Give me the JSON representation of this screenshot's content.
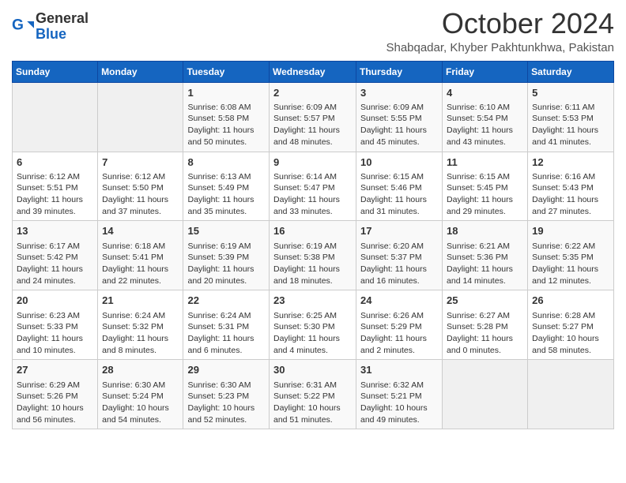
{
  "header": {
    "logo_general": "General",
    "logo_blue": "Blue",
    "month_title": "October 2024",
    "location": "Shabqadar, Khyber Pakhtunkhwa, Pakistan"
  },
  "days_of_week": [
    "Sunday",
    "Monday",
    "Tuesday",
    "Wednesday",
    "Thursday",
    "Friday",
    "Saturday"
  ],
  "weeks": [
    [
      {
        "day": "",
        "content": ""
      },
      {
        "day": "",
        "content": ""
      },
      {
        "day": "1",
        "content": "Sunrise: 6:08 AM\nSunset: 5:58 PM\nDaylight: 11 hours and 50 minutes."
      },
      {
        "day": "2",
        "content": "Sunrise: 6:09 AM\nSunset: 5:57 PM\nDaylight: 11 hours and 48 minutes."
      },
      {
        "day": "3",
        "content": "Sunrise: 6:09 AM\nSunset: 5:55 PM\nDaylight: 11 hours and 45 minutes."
      },
      {
        "day": "4",
        "content": "Sunrise: 6:10 AM\nSunset: 5:54 PM\nDaylight: 11 hours and 43 minutes."
      },
      {
        "day": "5",
        "content": "Sunrise: 6:11 AM\nSunset: 5:53 PM\nDaylight: 11 hours and 41 minutes."
      }
    ],
    [
      {
        "day": "6",
        "content": "Sunrise: 6:12 AM\nSunset: 5:51 PM\nDaylight: 11 hours and 39 minutes."
      },
      {
        "day": "7",
        "content": "Sunrise: 6:12 AM\nSunset: 5:50 PM\nDaylight: 11 hours and 37 minutes."
      },
      {
        "day": "8",
        "content": "Sunrise: 6:13 AM\nSunset: 5:49 PM\nDaylight: 11 hours and 35 minutes."
      },
      {
        "day": "9",
        "content": "Sunrise: 6:14 AM\nSunset: 5:47 PM\nDaylight: 11 hours and 33 minutes."
      },
      {
        "day": "10",
        "content": "Sunrise: 6:15 AM\nSunset: 5:46 PM\nDaylight: 11 hours and 31 minutes."
      },
      {
        "day": "11",
        "content": "Sunrise: 6:15 AM\nSunset: 5:45 PM\nDaylight: 11 hours and 29 minutes."
      },
      {
        "day": "12",
        "content": "Sunrise: 6:16 AM\nSunset: 5:43 PM\nDaylight: 11 hours and 27 minutes."
      }
    ],
    [
      {
        "day": "13",
        "content": "Sunrise: 6:17 AM\nSunset: 5:42 PM\nDaylight: 11 hours and 24 minutes."
      },
      {
        "day": "14",
        "content": "Sunrise: 6:18 AM\nSunset: 5:41 PM\nDaylight: 11 hours and 22 minutes."
      },
      {
        "day": "15",
        "content": "Sunrise: 6:19 AM\nSunset: 5:39 PM\nDaylight: 11 hours and 20 minutes."
      },
      {
        "day": "16",
        "content": "Sunrise: 6:19 AM\nSunset: 5:38 PM\nDaylight: 11 hours and 18 minutes."
      },
      {
        "day": "17",
        "content": "Sunrise: 6:20 AM\nSunset: 5:37 PM\nDaylight: 11 hours and 16 minutes."
      },
      {
        "day": "18",
        "content": "Sunrise: 6:21 AM\nSunset: 5:36 PM\nDaylight: 11 hours and 14 minutes."
      },
      {
        "day": "19",
        "content": "Sunrise: 6:22 AM\nSunset: 5:35 PM\nDaylight: 11 hours and 12 minutes."
      }
    ],
    [
      {
        "day": "20",
        "content": "Sunrise: 6:23 AM\nSunset: 5:33 PM\nDaylight: 11 hours and 10 minutes."
      },
      {
        "day": "21",
        "content": "Sunrise: 6:24 AM\nSunset: 5:32 PM\nDaylight: 11 hours and 8 minutes."
      },
      {
        "day": "22",
        "content": "Sunrise: 6:24 AM\nSunset: 5:31 PM\nDaylight: 11 hours and 6 minutes."
      },
      {
        "day": "23",
        "content": "Sunrise: 6:25 AM\nSunset: 5:30 PM\nDaylight: 11 hours and 4 minutes."
      },
      {
        "day": "24",
        "content": "Sunrise: 6:26 AM\nSunset: 5:29 PM\nDaylight: 11 hours and 2 minutes."
      },
      {
        "day": "25",
        "content": "Sunrise: 6:27 AM\nSunset: 5:28 PM\nDaylight: 11 hours and 0 minutes."
      },
      {
        "day": "26",
        "content": "Sunrise: 6:28 AM\nSunset: 5:27 PM\nDaylight: 10 hours and 58 minutes."
      }
    ],
    [
      {
        "day": "27",
        "content": "Sunrise: 6:29 AM\nSunset: 5:26 PM\nDaylight: 10 hours and 56 minutes."
      },
      {
        "day": "28",
        "content": "Sunrise: 6:30 AM\nSunset: 5:24 PM\nDaylight: 10 hours and 54 minutes."
      },
      {
        "day": "29",
        "content": "Sunrise: 6:30 AM\nSunset: 5:23 PM\nDaylight: 10 hours and 52 minutes."
      },
      {
        "day": "30",
        "content": "Sunrise: 6:31 AM\nSunset: 5:22 PM\nDaylight: 10 hours and 51 minutes."
      },
      {
        "day": "31",
        "content": "Sunrise: 6:32 AM\nSunset: 5:21 PM\nDaylight: 10 hours and 49 minutes."
      },
      {
        "day": "",
        "content": ""
      },
      {
        "day": "",
        "content": ""
      }
    ]
  ]
}
